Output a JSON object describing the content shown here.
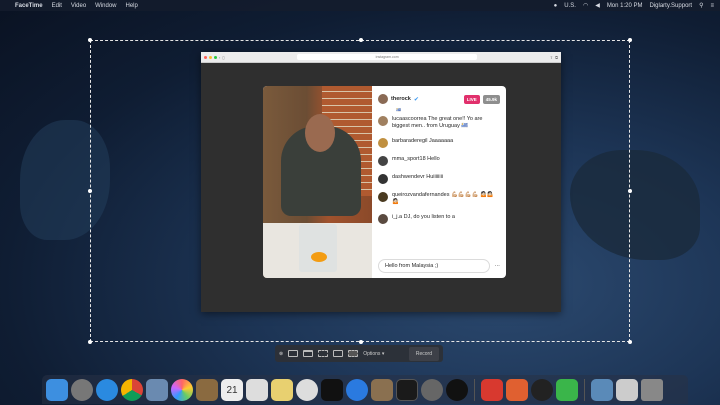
{
  "menubar": {
    "app": "FaceTime",
    "items": [
      "Edit",
      "Video",
      "Window",
      "Help"
    ],
    "input_source": "U.S.",
    "clock": "Mon 1:20 PM",
    "user": "Diglarty.Support"
  },
  "browser": {
    "address": "instagram.com"
  },
  "live": {
    "username": "therock",
    "live_badge": "LIVE",
    "viewers": "45.9k",
    "subtitle": "🇺🇾",
    "comments": [
      {
        "user": "lucaascoorrea",
        "text": "The great one!! Yo are biggest men.. from Uruguay 🇺🇾"
      },
      {
        "user": "barbaraderegil",
        "text": "Jaaaaaaa"
      },
      {
        "user": "mma_sport18",
        "text": "Hello"
      },
      {
        "user": "dashwendevr",
        "text": "Huiiiiiiii"
      },
      {
        "user": "queirozvandafernandes",
        "text": "💪🏼💪🏼💪🏼💪🏼 🤷🏻🤷🏻🤷🏻"
      },
      {
        "user": "i_j.a",
        "text": "DJ, do you listen to a"
      }
    ],
    "input_value": "Hello from Malaysia ;)",
    "more": "···"
  },
  "recorder": {
    "options": "Options ▾",
    "record": "Record"
  },
  "dock": {
    "icons": [
      "finder",
      "launchpad",
      "safari",
      "chrome",
      "preview",
      "photos",
      "notes-app",
      "calendar",
      "reminders",
      "notes",
      "itunes",
      "apple-tv",
      "app-store",
      "archive-utility",
      "terminal",
      "system-preferences",
      "audio",
      "anydesk",
      "presentation",
      "qq",
      "facetime",
      "folder",
      "screenshot-app",
      "trash"
    ],
    "calendar_day": "21"
  }
}
